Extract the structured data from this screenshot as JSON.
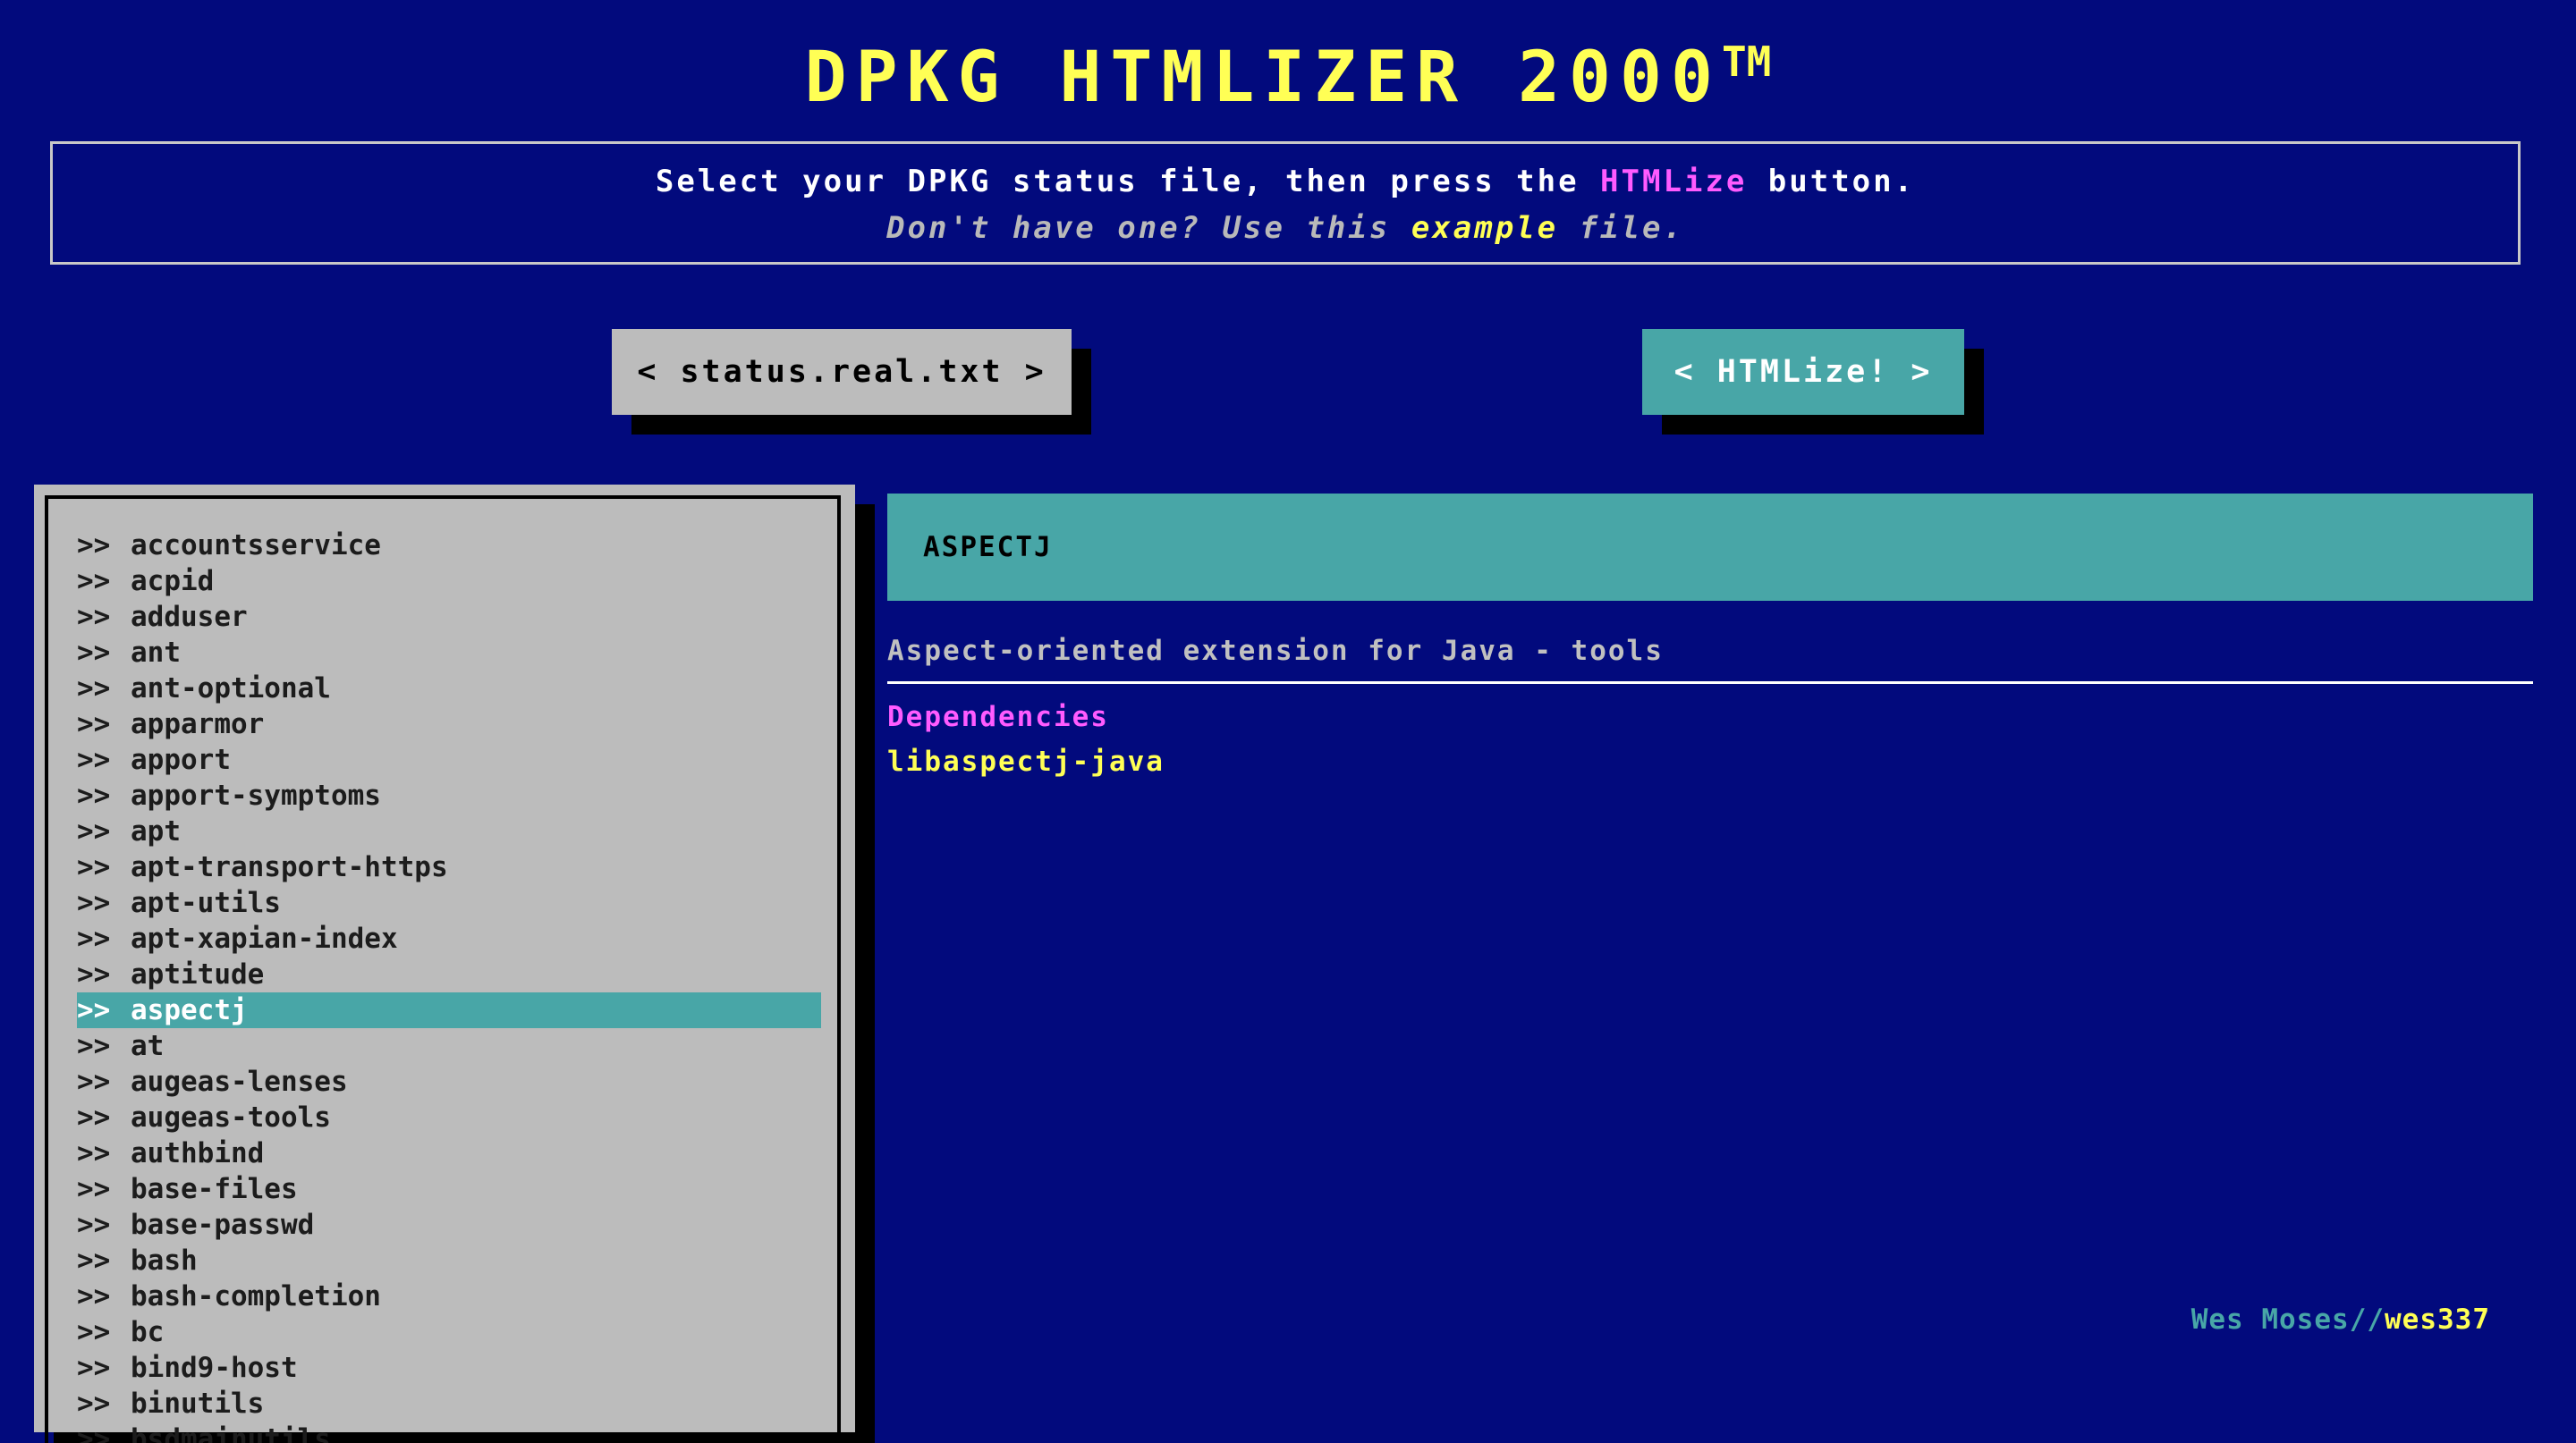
{
  "app": {
    "title": "DPKG HTMLIZER 2000",
    "trademark": "TM"
  },
  "intro": {
    "line1_before": "Select your DPKG status file, then press the ",
    "line1_highlight": "HTMLize",
    "line1_after": " button.",
    "line2_before": "Don't have one? Use this ",
    "line2_link": "example",
    "line2_after": " file."
  },
  "buttons": {
    "file_label": "< status.real.txt >",
    "htmlize_label": "< HTMLize! >"
  },
  "package_list": {
    "arrow": ">>",
    "selected": "aspectj",
    "items": [
      "accountsservice",
      "acpid",
      "adduser",
      "ant",
      "ant-optional",
      "apparmor",
      "apport",
      "apport-symptoms",
      "apt",
      "apt-transport-https",
      "apt-utils",
      "apt-xapian-index",
      "aptitude",
      "aspectj",
      "at",
      "augeas-lenses",
      "augeas-tools",
      "authbind",
      "base-files",
      "base-passwd",
      "bash",
      "bash-completion",
      "bc",
      "bind9-host",
      "binutils",
      "bsdmainutils"
    ]
  },
  "detail": {
    "name": "ASPECTJ",
    "description": "Aspect-oriented extension for Java - tools",
    "dependencies_heading": "Dependencies",
    "dependencies": [
      "libaspectj-java"
    ]
  },
  "credit": {
    "author": "Wes Moses",
    "separator": "//",
    "handle": "wes337"
  },
  "colors": {
    "background": "#020a7d",
    "title": "#ffff55",
    "accent_teal": "#48a6a7",
    "accent_magenta": "#ff5bff",
    "panel_gray": "#bcbcbc"
  }
}
